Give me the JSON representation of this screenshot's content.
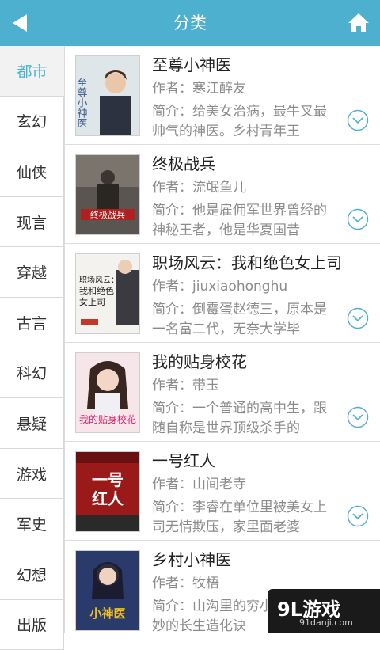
{
  "header": {
    "title": "分类",
    "back_icon": "back-arrow-icon",
    "home_icon": "home-icon"
  },
  "sidebar": {
    "active_index": 0,
    "items": [
      {
        "label": "都市"
      },
      {
        "label": "玄幻"
      },
      {
        "label": "仙侠"
      },
      {
        "label": "现言"
      },
      {
        "label": "穿越"
      },
      {
        "label": "古言"
      },
      {
        "label": "科幻"
      },
      {
        "label": "悬疑"
      },
      {
        "label": "游戏"
      },
      {
        "label": "军史"
      },
      {
        "label": "幻想"
      },
      {
        "label": "出版"
      }
    ]
  },
  "books": [
    {
      "title": "至尊小神医",
      "author": "作者：寒江醉友",
      "desc": "简介：给美女治病，最牛叉最帅气的神医。乡村青年王"
    },
    {
      "title": "终极战兵",
      "author": "作者：流氓鱼儿",
      "desc": "简介：他是雇佣军世界曾经的神秘王者，他是华夏国昔"
    },
    {
      "title": "职场风云：我和绝色女上司",
      "author": "作者：jiuxiaohonghu",
      "desc": "简介：倒霉蛋赵德三，原本是一名富二代，无奈大学毕"
    },
    {
      "title": "我的贴身校花",
      "author": "作者：带玉",
      "desc": "简介：一个普通的高中生，跟随自称是世界顶级杀手的"
    },
    {
      "title": "一号红人",
      "author": "作者：山间老寺",
      "desc": "简介：李睿在单位里被美女上司无情欺压，家里面老婆"
    },
    {
      "title": "乡村小神医",
      "author": "作者：牧梧",
      "desc": "简介：山沟里的穷小子得到玄妙的长生造化诀"
    }
  ],
  "covers": {
    "c1_title": "至尊小神医",
    "c2_title": "终极战兵",
    "c3_title_a": "职场风云：",
    "c3_title_b": "我和绝色",
    "c3_title_c": "女上司",
    "c4_title": "我的贴身校花",
    "c5_title_a": "一号",
    "c5_title_b": "红人",
    "c6_title": "小神医"
  },
  "watermark": {
    "text": "9L游戏",
    "sub": "91danji.com"
  },
  "colors": {
    "accent": "#4db0cf",
    "text": "#222222",
    "muted": "#8c8c8c"
  }
}
